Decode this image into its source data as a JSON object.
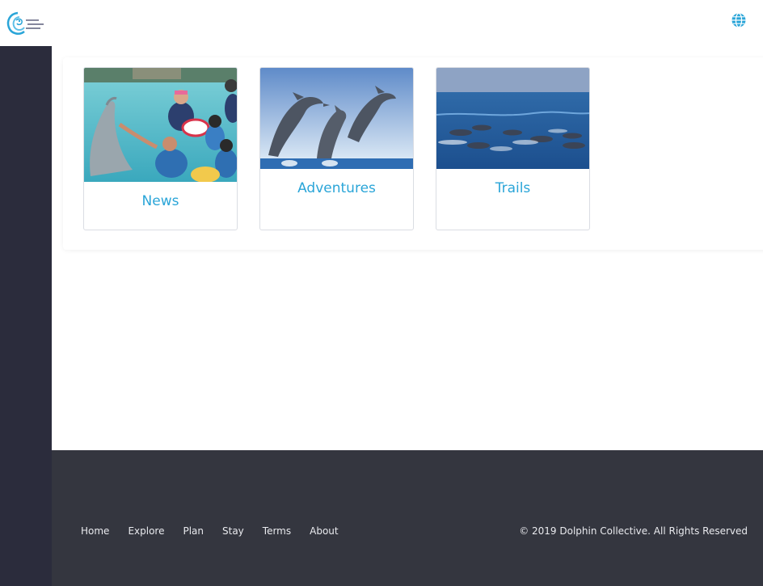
{
  "brand": {
    "logo_icon": "dolphin-wave-logo",
    "menu_icon": "hamburger-menu-icon"
  },
  "header": {
    "language_icon": "globe-icon",
    "accent": "#2aa5d8"
  },
  "cards": [
    {
      "title": "News",
      "image": "children-with-dolphin-photo"
    },
    {
      "title": "Adventures",
      "image": "jumping-dolphins-photo"
    },
    {
      "title": "Trails",
      "image": "dolphin-pod-ocean-photo"
    }
  ],
  "footer": {
    "links": [
      "Home",
      "Explore",
      "Plan",
      "Stay",
      "Terms",
      "About"
    ],
    "copyright": "© 2019 Dolphin Collective. All Rights Reserved"
  },
  "colors": {
    "sidebar": "#2b2c3c",
    "footer": "#34363f",
    "card_title": "#2aa5d8"
  }
}
